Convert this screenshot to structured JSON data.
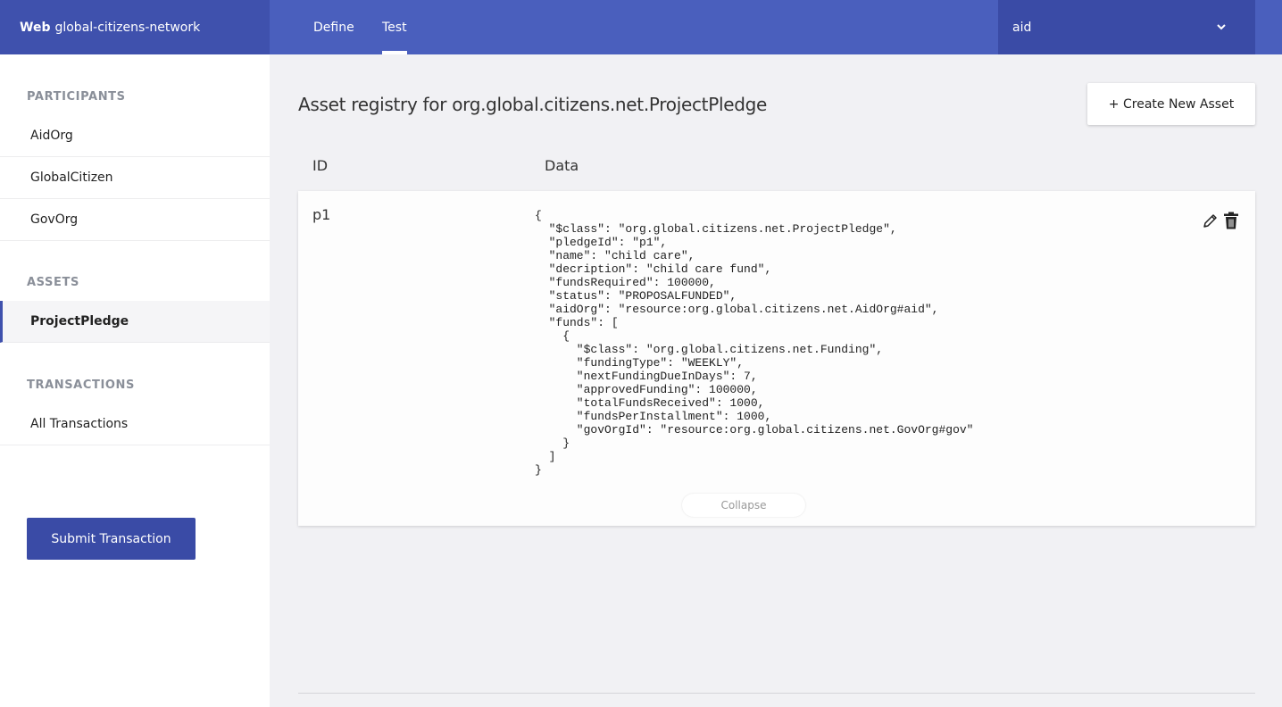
{
  "header": {
    "brand_bold": "Web",
    "brand_name": "global-citizens-network",
    "tabs": [
      {
        "label": "Define",
        "active": false
      },
      {
        "label": "Test",
        "active": true
      }
    ],
    "identity": {
      "value": "aid",
      "icon": "chevron-down-icon"
    }
  },
  "sidebar": {
    "participants_heading": "PARTICIPANTS",
    "participants": [
      "AidOrg",
      "GlobalCitizen",
      "GovOrg"
    ],
    "assets_heading": "ASSETS",
    "assets": [
      {
        "label": "ProjectPledge",
        "active": true
      }
    ],
    "transactions_heading": "TRANSACTIONS",
    "transactions": [
      "All Transactions"
    ],
    "submit_label": "Submit Transaction"
  },
  "main": {
    "title": "Asset registry for org.global.citizens.net.ProjectPledge",
    "create_label": "+ Create New Asset",
    "columns": {
      "id": "ID",
      "data": "Data"
    },
    "assets": [
      {
        "id": "p1",
        "data": "{\n  \"$class\": \"org.global.citizens.net.ProjectPledge\",\n  \"pledgeId\": \"p1\",\n  \"name\": \"child care\",\n  \"decription\": \"child care fund\",\n  \"fundsRequired\": 100000,\n  \"status\": \"PROPOSALFUNDED\",\n  \"aidOrg\": \"resource:org.global.citizens.net.AidOrg#aid\",\n  \"funds\": [\n    {\n      \"$class\": \"org.global.citizens.net.Funding\",\n      \"fundingType\": \"WEEKLY\",\n      \"nextFundingDueInDays\": 7,\n      \"approvedFunding\": 100000,\n      \"totalFundsReceived\": 1000,\n      \"fundsPerInstallment\": 1000,\n      \"govOrgId\": \"resource:org.global.citizens.net.GovOrg#gov\"\n    }\n  ]\n}",
        "collapse_label": "Collapse",
        "edit_icon": "pencil-icon",
        "delete_icon": "trash-icon"
      }
    ]
  }
}
